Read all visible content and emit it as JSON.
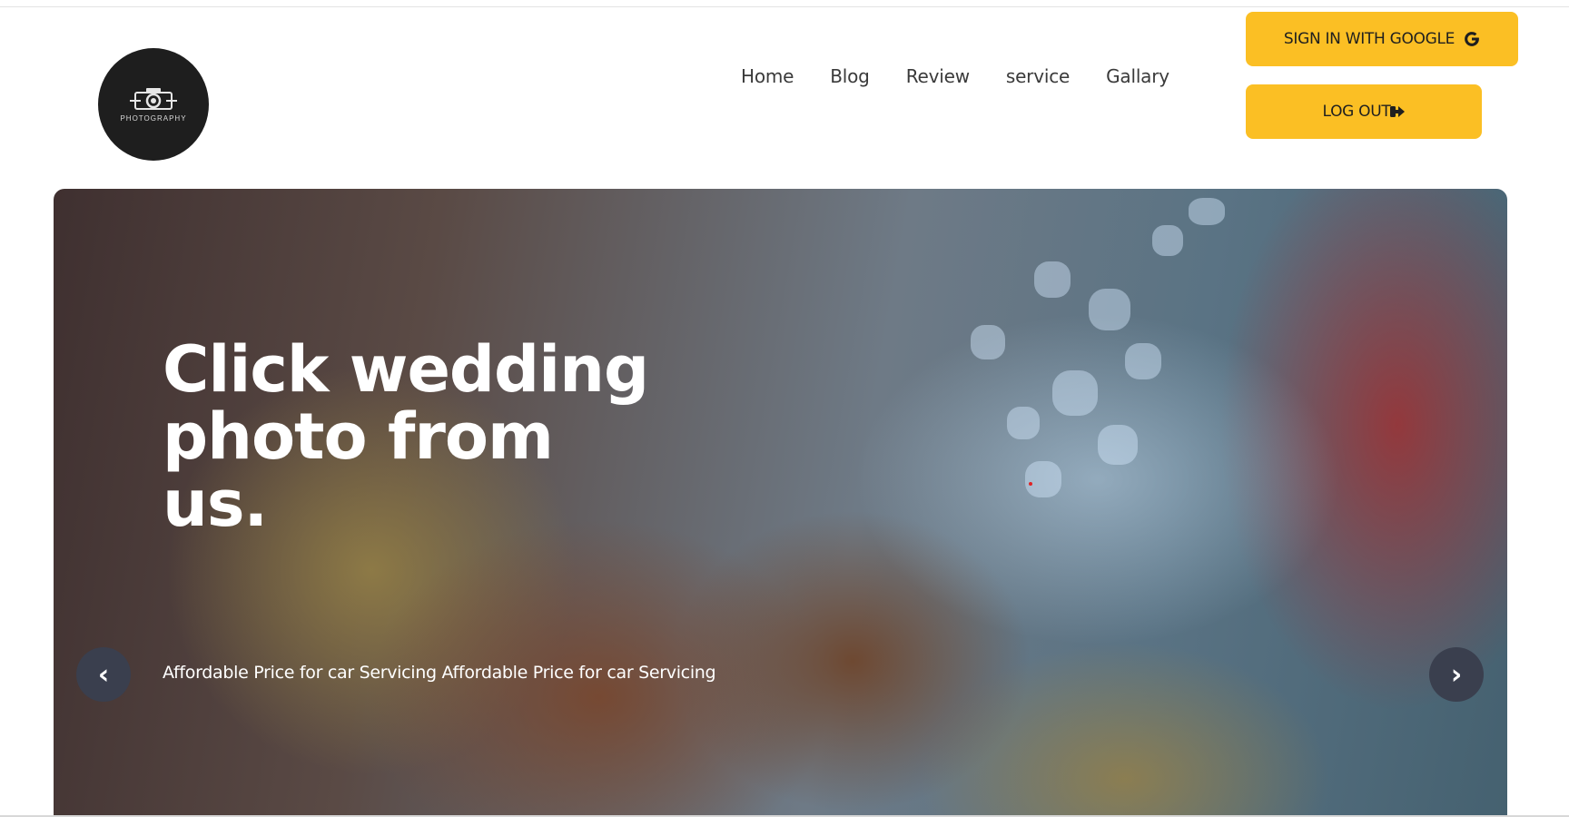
{
  "header": {
    "logo": {
      "icon": "camera-icon",
      "text": "PHOTOGRAPHY"
    },
    "nav": [
      {
        "label": "Home"
      },
      {
        "label": "Blog"
      },
      {
        "label": "Review"
      },
      {
        "label": "service"
      },
      {
        "label": "Gallary"
      }
    ],
    "auth": {
      "google_label": "SIGN IN WITH GOOGLE",
      "google_icon": "google-icon",
      "logout_label": "LOG OUT",
      "logout_icon": "sign-out-icon"
    }
  },
  "hero": {
    "title": "Click wedding photo from us.",
    "subtitle": "Affordable Price for car Servicing Affordable Price for car Servicing",
    "prev_icon": "‹",
    "next_icon": "›"
  },
  "colors": {
    "accent": "#fbbf24",
    "logo_bg": "#1e1e1e",
    "carousel_button": "#3a3f4e"
  }
}
